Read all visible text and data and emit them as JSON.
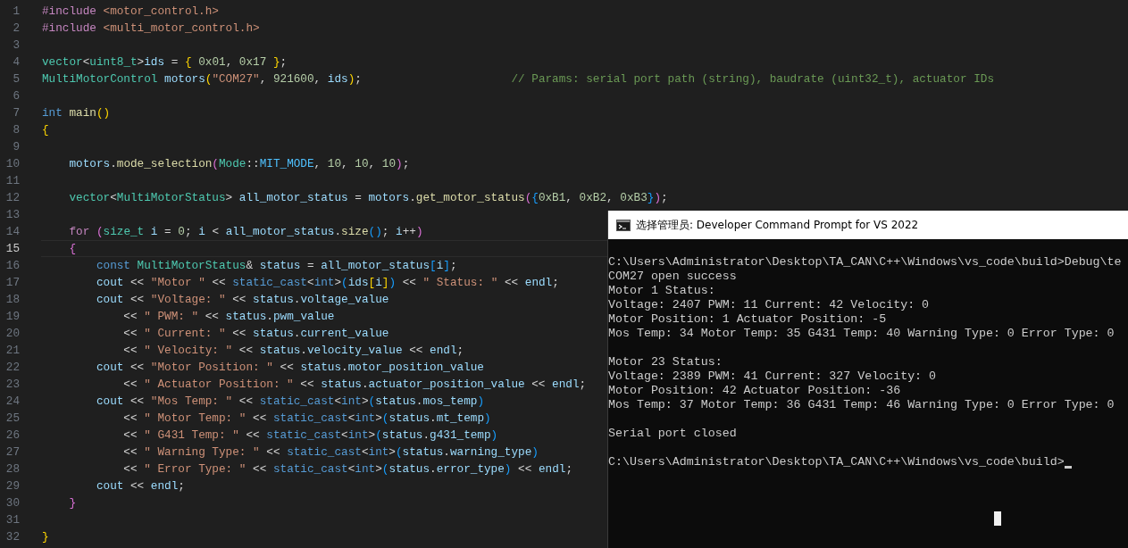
{
  "editor": {
    "lines": [
      {
        "number": "1",
        "current": false,
        "tokens": [
          {
            "kind": "ctl",
            "text": "#include "
          },
          {
            "kind": "str",
            "text": "<motor_control.h>"
          }
        ]
      },
      {
        "number": "2",
        "current": false,
        "tokens": [
          {
            "kind": "ctl",
            "text": "#include "
          },
          {
            "kind": "str",
            "text": "<multi_motor_control.h>"
          }
        ]
      },
      {
        "number": "3",
        "current": false
      },
      {
        "number": "4",
        "current": false,
        "tokens": [
          {
            "kind": "type",
            "text": "vector"
          },
          {
            "kind": "op",
            "text": "<"
          },
          {
            "kind": "type",
            "text": "uint8_t"
          },
          {
            "kind": "op",
            "text": ">"
          },
          {
            "kind": "var",
            "text": "ids"
          },
          {
            "kind": "op",
            "text": " = "
          },
          {
            "kind": "b1",
            "text": "{ "
          },
          {
            "kind": "num",
            "text": "0x01"
          },
          {
            "kind": "op",
            "text": ", "
          },
          {
            "kind": "num",
            "text": "0x17"
          },
          {
            "kind": "b1",
            "text": " }"
          },
          {
            "kind": "op",
            "text": ";"
          }
        ]
      },
      {
        "number": "5",
        "current": false,
        "tokens": [
          {
            "kind": "type",
            "text": "MultiMotorControl "
          },
          {
            "kind": "var",
            "text": "motors"
          },
          {
            "kind": "b1",
            "text": "("
          },
          {
            "kind": "str",
            "text": "\"COM27\""
          },
          {
            "kind": "op",
            "text": ", "
          },
          {
            "kind": "num",
            "text": "921600"
          },
          {
            "kind": "op",
            "text": ", "
          },
          {
            "kind": "var",
            "text": "ids"
          },
          {
            "kind": "b1",
            "text": ")"
          },
          {
            "kind": "op",
            "text": ";                      "
          },
          {
            "kind": "com",
            "text": "// Params: serial port path (string), baudrate (uint32_t), actuator IDs"
          }
        ]
      },
      {
        "number": "6",
        "current": false
      },
      {
        "number": "7",
        "current": false,
        "tokens": [
          {
            "kind": "kw",
            "text": "int "
          },
          {
            "kind": "fn",
            "text": "main"
          },
          {
            "kind": "b1",
            "text": "()"
          }
        ]
      },
      {
        "number": "8",
        "current": false,
        "tokens": [
          {
            "kind": "b1",
            "text": "{"
          }
        ]
      },
      {
        "number": "9",
        "current": false
      },
      {
        "number": "10",
        "current": false,
        "tokens": [
          {
            "kind": "var",
            "text": "    motors"
          },
          {
            "kind": "op",
            "text": "."
          },
          {
            "kind": "fn",
            "text": "mode_selection"
          },
          {
            "kind": "b2",
            "text": "("
          },
          {
            "kind": "type",
            "text": "Mode"
          },
          {
            "kind": "op",
            "text": "::"
          },
          {
            "kind": "const",
            "text": "MIT_MODE"
          },
          {
            "kind": "op",
            "text": ", "
          },
          {
            "kind": "num",
            "text": "10"
          },
          {
            "kind": "op",
            "text": ", "
          },
          {
            "kind": "num",
            "text": "10"
          },
          {
            "kind": "op",
            "text": ", "
          },
          {
            "kind": "num",
            "text": "10"
          },
          {
            "kind": "b2",
            "text": ")"
          },
          {
            "kind": "op",
            "text": ";"
          }
        ]
      },
      {
        "number": "11",
        "current": false
      },
      {
        "number": "12",
        "current": false,
        "tokens": [
          {
            "kind": "type",
            "text": "    vector"
          },
          {
            "kind": "op",
            "text": "<"
          },
          {
            "kind": "type",
            "text": "MultiMotorStatus"
          },
          {
            "kind": "op",
            "text": "> "
          },
          {
            "kind": "var",
            "text": "all_motor_status"
          },
          {
            "kind": "op",
            "text": " = "
          },
          {
            "kind": "var",
            "text": "motors"
          },
          {
            "kind": "op",
            "text": "."
          },
          {
            "kind": "fn",
            "text": "get_motor_status"
          },
          {
            "kind": "b2",
            "text": "("
          },
          {
            "kind": "b3",
            "text": "{"
          },
          {
            "kind": "num",
            "text": "0xB1"
          },
          {
            "kind": "op",
            "text": ", "
          },
          {
            "kind": "num",
            "text": "0xB2"
          },
          {
            "kind": "op",
            "text": ", "
          },
          {
            "kind": "num",
            "text": "0xB3"
          },
          {
            "kind": "b3",
            "text": "}"
          },
          {
            "kind": "b2",
            "text": ")"
          },
          {
            "kind": "op",
            "text": ";"
          }
        ]
      },
      {
        "number": "13",
        "current": false
      },
      {
        "number": "14",
        "current": false,
        "tokens": [
          {
            "kind": "ctl",
            "text": "    for "
          },
          {
            "kind": "b2",
            "text": "("
          },
          {
            "kind": "type",
            "text": "size_t "
          },
          {
            "kind": "var",
            "text": "i"
          },
          {
            "kind": "op",
            "text": " = "
          },
          {
            "kind": "num",
            "text": "0"
          },
          {
            "kind": "op",
            "text": "; "
          },
          {
            "kind": "var",
            "text": "i"
          },
          {
            "kind": "op",
            "text": " < "
          },
          {
            "kind": "var",
            "text": "all_motor_status"
          },
          {
            "kind": "op",
            "text": "."
          },
          {
            "kind": "fn",
            "text": "size"
          },
          {
            "kind": "b3",
            "text": "()"
          },
          {
            "kind": "op",
            "text": "; "
          },
          {
            "kind": "var",
            "text": "i"
          },
          {
            "kind": "op",
            "text": "++"
          },
          {
            "kind": "b2",
            "text": ")"
          }
        ]
      },
      {
        "number": "15",
        "current": true,
        "tokens": [
          {
            "kind": "b2",
            "text": "    {"
          }
        ]
      },
      {
        "number": "16",
        "current": false,
        "tokens": [
          {
            "kind": "kw",
            "text": "        const "
          },
          {
            "kind": "type",
            "text": "MultiMotorStatus"
          },
          {
            "kind": "op",
            "text": "& "
          },
          {
            "kind": "var",
            "text": "status"
          },
          {
            "kind": "op",
            "text": " = "
          },
          {
            "kind": "var",
            "text": "all_motor_status"
          },
          {
            "kind": "b3",
            "text": "["
          },
          {
            "kind": "var",
            "text": "i"
          },
          {
            "kind": "b3",
            "text": "]"
          },
          {
            "kind": "op",
            "text": ";"
          }
        ]
      },
      {
        "number": "17",
        "current": false,
        "tokens": [
          {
            "kind": "var",
            "text": "        cout"
          },
          {
            "kind": "op",
            "text": " << "
          },
          {
            "kind": "str",
            "text": "\"Motor \""
          },
          {
            "kind": "op",
            "text": " << "
          },
          {
            "kind": "kw",
            "text": "static_cast"
          },
          {
            "kind": "op",
            "text": "<"
          },
          {
            "kind": "kw",
            "text": "int"
          },
          {
            "kind": "op",
            "text": ">"
          },
          {
            "kind": "b3",
            "text": "("
          },
          {
            "kind": "var",
            "text": "ids"
          },
          {
            "kind": "b1",
            "text": "["
          },
          {
            "kind": "var",
            "text": "i"
          },
          {
            "kind": "b1",
            "text": "]"
          },
          {
            "kind": "b3",
            "text": ")"
          },
          {
            "kind": "op",
            "text": " << "
          },
          {
            "kind": "str",
            "text": "\" Status: \""
          },
          {
            "kind": "op",
            "text": " << "
          },
          {
            "kind": "var",
            "text": "endl"
          },
          {
            "kind": "op",
            "text": ";"
          }
        ]
      },
      {
        "number": "18",
        "current": false,
        "tokens": [
          {
            "kind": "var",
            "text": "        cout"
          },
          {
            "kind": "op",
            "text": " << "
          },
          {
            "kind": "str",
            "text": "\"Voltage: \""
          },
          {
            "kind": "op",
            "text": " << "
          },
          {
            "kind": "var",
            "text": "status"
          },
          {
            "kind": "op",
            "text": "."
          },
          {
            "kind": "var",
            "text": "voltage_value"
          }
        ]
      },
      {
        "number": "19",
        "current": false,
        "tokens": [
          {
            "kind": "op",
            "text": "            << "
          },
          {
            "kind": "str",
            "text": "\" PWM: \""
          },
          {
            "kind": "op",
            "text": " << "
          },
          {
            "kind": "var",
            "text": "status"
          },
          {
            "kind": "op",
            "text": "."
          },
          {
            "kind": "var",
            "text": "pwm_value"
          }
        ]
      },
      {
        "number": "20",
        "current": false,
        "tokens": [
          {
            "kind": "op",
            "text": "            << "
          },
          {
            "kind": "str",
            "text": "\" Current: \""
          },
          {
            "kind": "op",
            "text": " << "
          },
          {
            "kind": "var",
            "text": "status"
          },
          {
            "kind": "op",
            "text": "."
          },
          {
            "kind": "var",
            "text": "current_value"
          }
        ]
      },
      {
        "number": "21",
        "current": false,
        "tokens": [
          {
            "kind": "op",
            "text": "            << "
          },
          {
            "kind": "str",
            "text": "\" Velocity: \""
          },
          {
            "kind": "op",
            "text": " << "
          },
          {
            "kind": "var",
            "text": "status"
          },
          {
            "kind": "op",
            "text": "."
          },
          {
            "kind": "var",
            "text": "velocity_value"
          },
          {
            "kind": "op",
            "text": " << "
          },
          {
            "kind": "var",
            "text": "endl"
          },
          {
            "kind": "op",
            "text": ";"
          }
        ]
      },
      {
        "number": "22",
        "current": false,
        "tokens": [
          {
            "kind": "var",
            "text": "        cout"
          },
          {
            "kind": "op",
            "text": " << "
          },
          {
            "kind": "str",
            "text": "\"Motor Position: \""
          },
          {
            "kind": "op",
            "text": " << "
          },
          {
            "kind": "var",
            "text": "status"
          },
          {
            "kind": "op",
            "text": "."
          },
          {
            "kind": "var",
            "text": "motor_position_value"
          }
        ]
      },
      {
        "number": "23",
        "current": false,
        "tokens": [
          {
            "kind": "op",
            "text": "            << "
          },
          {
            "kind": "str",
            "text": "\" Actuator Position: \""
          },
          {
            "kind": "op",
            "text": " << "
          },
          {
            "kind": "var",
            "text": "status"
          },
          {
            "kind": "op",
            "text": "."
          },
          {
            "kind": "var",
            "text": "actuator_position_value"
          },
          {
            "kind": "op",
            "text": " << "
          },
          {
            "kind": "var",
            "text": "endl"
          },
          {
            "kind": "op",
            "text": ";"
          }
        ]
      },
      {
        "number": "24",
        "current": false,
        "tokens": [
          {
            "kind": "var",
            "text": "        cout"
          },
          {
            "kind": "op",
            "text": " << "
          },
          {
            "kind": "str",
            "text": "\"Mos Temp: \""
          },
          {
            "kind": "op",
            "text": " << "
          },
          {
            "kind": "kw",
            "text": "static_cast"
          },
          {
            "kind": "op",
            "text": "<"
          },
          {
            "kind": "kw",
            "text": "int"
          },
          {
            "kind": "op",
            "text": ">"
          },
          {
            "kind": "b3",
            "text": "("
          },
          {
            "kind": "var",
            "text": "status"
          },
          {
            "kind": "op",
            "text": "."
          },
          {
            "kind": "var",
            "text": "mos_temp"
          },
          {
            "kind": "b3",
            "text": ")"
          }
        ]
      },
      {
        "number": "25",
        "current": false,
        "tokens": [
          {
            "kind": "op",
            "text": "            << "
          },
          {
            "kind": "str",
            "text": "\" Motor Temp: \""
          },
          {
            "kind": "op",
            "text": " << "
          },
          {
            "kind": "kw",
            "text": "static_cast"
          },
          {
            "kind": "op",
            "text": "<"
          },
          {
            "kind": "kw",
            "text": "int"
          },
          {
            "kind": "op",
            "text": ">"
          },
          {
            "kind": "b3",
            "text": "("
          },
          {
            "kind": "var",
            "text": "status"
          },
          {
            "kind": "op",
            "text": "."
          },
          {
            "kind": "var",
            "text": "mt_temp"
          },
          {
            "kind": "b3",
            "text": ")"
          }
        ]
      },
      {
        "number": "26",
        "current": false,
        "tokens": [
          {
            "kind": "op",
            "text": "            << "
          },
          {
            "kind": "str",
            "text": "\" G431 Temp: \""
          },
          {
            "kind": "op",
            "text": " << "
          },
          {
            "kind": "kw",
            "text": "static_cast"
          },
          {
            "kind": "op",
            "text": "<"
          },
          {
            "kind": "kw",
            "text": "int"
          },
          {
            "kind": "op",
            "text": ">"
          },
          {
            "kind": "b3",
            "text": "("
          },
          {
            "kind": "var",
            "text": "status"
          },
          {
            "kind": "op",
            "text": "."
          },
          {
            "kind": "var",
            "text": "g431_temp"
          },
          {
            "kind": "b3",
            "text": ")"
          }
        ]
      },
      {
        "number": "27",
        "current": false,
        "tokens": [
          {
            "kind": "op",
            "text": "            << "
          },
          {
            "kind": "str",
            "text": "\" Warning Type: \""
          },
          {
            "kind": "op",
            "text": " << "
          },
          {
            "kind": "kw",
            "text": "static_cast"
          },
          {
            "kind": "op",
            "text": "<"
          },
          {
            "kind": "kw",
            "text": "int"
          },
          {
            "kind": "op",
            "text": ">"
          },
          {
            "kind": "b3",
            "text": "("
          },
          {
            "kind": "var",
            "text": "status"
          },
          {
            "kind": "op",
            "text": "."
          },
          {
            "kind": "var",
            "text": "warning_type"
          },
          {
            "kind": "b3",
            "text": ")"
          }
        ]
      },
      {
        "number": "28",
        "current": false,
        "tokens": [
          {
            "kind": "op",
            "text": "            << "
          },
          {
            "kind": "str",
            "text": "\" Error Type: \""
          },
          {
            "kind": "op",
            "text": " << "
          },
          {
            "kind": "kw",
            "text": "static_cast"
          },
          {
            "kind": "op",
            "text": "<"
          },
          {
            "kind": "kw",
            "text": "int"
          },
          {
            "kind": "op",
            "text": ">"
          },
          {
            "kind": "b3",
            "text": "("
          },
          {
            "kind": "var",
            "text": "status"
          },
          {
            "kind": "op",
            "text": "."
          },
          {
            "kind": "var",
            "text": "error_type"
          },
          {
            "kind": "b3",
            "text": ")"
          },
          {
            "kind": "op",
            "text": " << "
          },
          {
            "kind": "var",
            "text": "endl"
          },
          {
            "kind": "op",
            "text": ";"
          }
        ]
      },
      {
        "number": "29",
        "current": false,
        "tokens": [
          {
            "kind": "var",
            "text": "        cout"
          },
          {
            "kind": "op",
            "text": " << "
          },
          {
            "kind": "var",
            "text": "endl"
          },
          {
            "kind": "op",
            "text": ";"
          }
        ]
      },
      {
        "number": "30",
        "current": false,
        "tokens": [
          {
            "kind": "b2",
            "text": "    }"
          }
        ]
      },
      {
        "number": "31",
        "current": false
      },
      {
        "number": "32",
        "current": false,
        "tokens": [
          {
            "kind": "b1",
            "text": "}"
          }
        ]
      }
    ]
  },
  "console": {
    "title": "选择管理员: Developer Command Prompt for VS 2022",
    "blocks": [
      [
        "C:\\Users\\Administrator\\Desktop\\TA_CAN\\C++\\Windows\\vs_code\\build>Debug\\te",
        "COM27 open success",
        "Motor 1 Status:",
        "Voltage: 2407 PWM: 11 Current: 42 Velocity: 0",
        "Motor Position: 1 Actuator Position: -5",
        "Mos Temp: 34 Motor Temp: 35 G431 Temp: 40 Warning Type: 0 Error Type: 0"
      ],
      [
        "Motor 23 Status:",
        "Voltage: 2389 PWM: 41 Current: 327 Velocity: 0",
        "Motor Position: 42 Actuator Position: -36",
        "Mos Temp: 37 Motor Temp: 36 G431 Temp: 46 Warning Type: 0 Error Type: 0"
      ],
      [
        "Serial port closed"
      ],
      [
        "C:\\Users\\Administrator\\Desktop\\TA_CAN\\C++\\Windows\\vs_code\\build>"
      ]
    ],
    "prompt_cursor": true
  }
}
